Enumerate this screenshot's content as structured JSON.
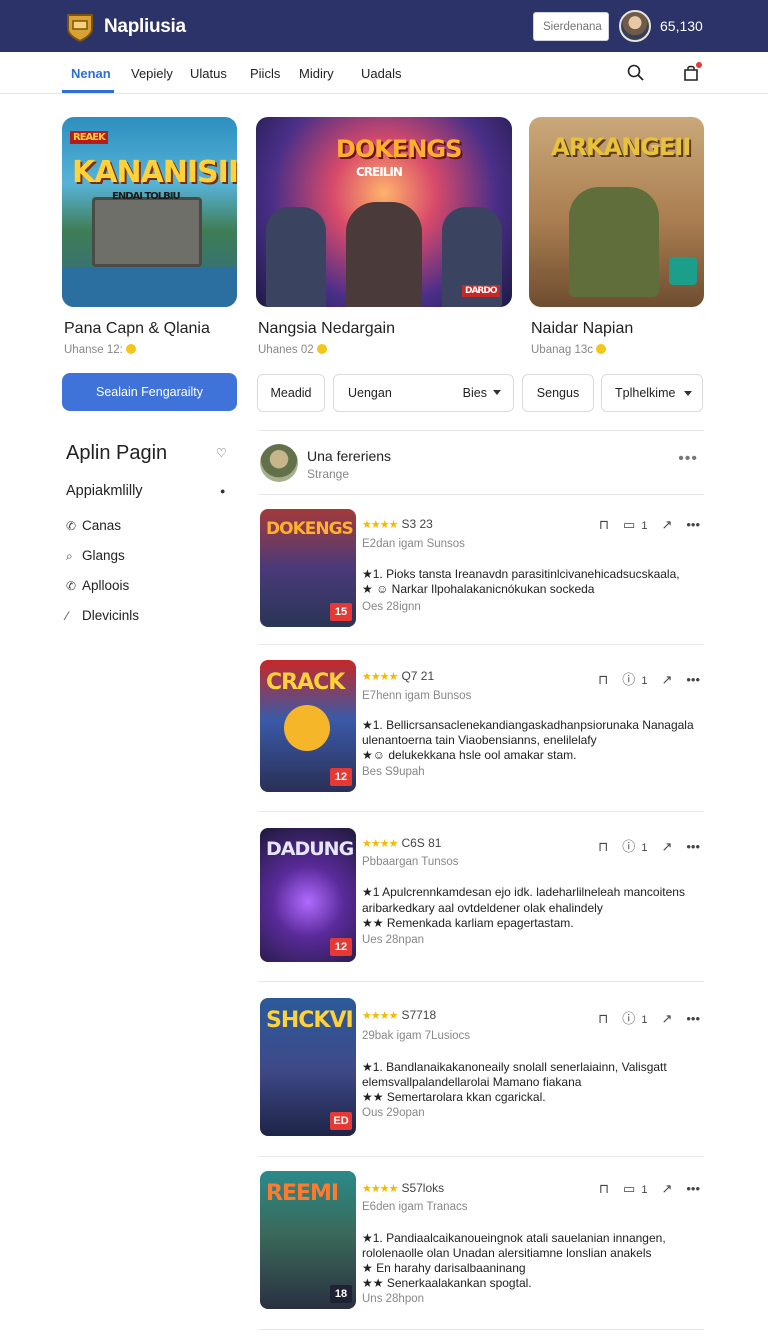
{
  "app": {
    "brand": "Napliusia",
    "search_placeholder": "Sierdenana",
    "coins": "65,130"
  },
  "nav": {
    "tabs": [
      "Nenan",
      "Vepiely",
      "Ulatus",
      "Piicls",
      "Midiry",
      "Uadals"
    ]
  },
  "featured": [
    {
      "art_title": "KANANISII",
      "art_sub": "ENDAI TOLBIU",
      "art_tag": "REAEK",
      "name": "Pana Capn & Qlania",
      "meta": "Uhanse 12:"
    },
    {
      "art_title": "DOKENGS",
      "art_sub": "CREILIN",
      "art_tag": "DARDO",
      "name": "Nangsia Nedargain",
      "meta": "Uhanes 02"
    },
    {
      "art_title": "ARKANGEII",
      "art_sub": "",
      "art_tag": "",
      "name": "Naidar Napian",
      "meta": "Ubanag 13c"
    }
  ],
  "filters": {
    "primary": "Sealain Fengarailty",
    "chips": [
      "Meadid",
      "Uengan",
      "Bies",
      "Sengus",
      "Tplhelkime"
    ]
  },
  "sidebar": {
    "title": "Aplin Pagin",
    "subtitle": "Appiakmlilly",
    "items": [
      {
        "label": "Canas",
        "icon": "chat-icon"
      },
      {
        "label": "Glangs",
        "icon": "search-icon"
      },
      {
        "label": "Aplloois",
        "icon": "chat-icon"
      },
      {
        "label": "Dlevicinls",
        "icon": "link-icon"
      }
    ]
  },
  "post": {
    "user": "Una fereriens",
    "sub": "Strange"
  },
  "items": [
    {
      "art": "DOKENGS",
      "num": "15",
      "rating": "S3 23",
      "sub": "E2dan igam Sunsos",
      "lines": [
        "★1. Pioks tansta Ireanavdn parasitinlcivanehicadsucskaala,",
        "★ ☺ Narkar Ilpohalakanicnókukan sockeda"
      ],
      "date": "Oes 28ignn",
      "comments": "1"
    },
    {
      "art": "CRACK",
      "num": "12",
      "rating": "Q7 21",
      "sub": "E7henn igam Bunsos",
      "lines": [
        "★1. Bellicrsansaclenekandiangaskadhanpsiorunaka Nanagala",
        "ulenantoerna tain Viaobensianns, enelilelafy",
        "★☺ delukekkana hsle ool amakar stam."
      ],
      "date": "Bes S9upah",
      "comments": "1"
    },
    {
      "art": "DADUNG",
      "num": "12",
      "rating": "C6S 81",
      "sub": "Pbbaargan Tunsos",
      "lines": [
        "★1 Apulcrennkamdesan ejo idk. ladeharlilneleah mancoitens",
        "aribarkedkary aal ovtdeldener olak ehalindely",
        "★★ Remenkada karliam epagertastam."
      ],
      "date": "Ues 28npan",
      "comments": "1"
    },
    {
      "art": "SHCKVI",
      "num": "ED",
      "rating": "S7718",
      "sub": "29bak igam 7Lusiocs",
      "lines": [
        "★1. Bandlanaikakanoneaily snolall senerlaiainn, Valisgatt",
        "elemsvallpalandellarolai Mamano fiakana",
        "★★ Semertarolara kkan cgarickal."
      ],
      "date": "Ous 29opan",
      "comments": "1"
    },
    {
      "art": "REEMI",
      "num": "18",
      "rating": "S57loks",
      "sub": "E6den igam Tranacs",
      "lines": [
        "★1. Pandiaalcaikanoueingnok atali sauelanian innangen,",
        "rololenaolle olan Unadan alersitiamne lonslian anakels",
        "★ En harahy darisalbaaninang",
        "★★ Senerkaalakankan spogtal."
      ],
      "date": "Uns 28hpon",
      "comments": "1"
    }
  ]
}
